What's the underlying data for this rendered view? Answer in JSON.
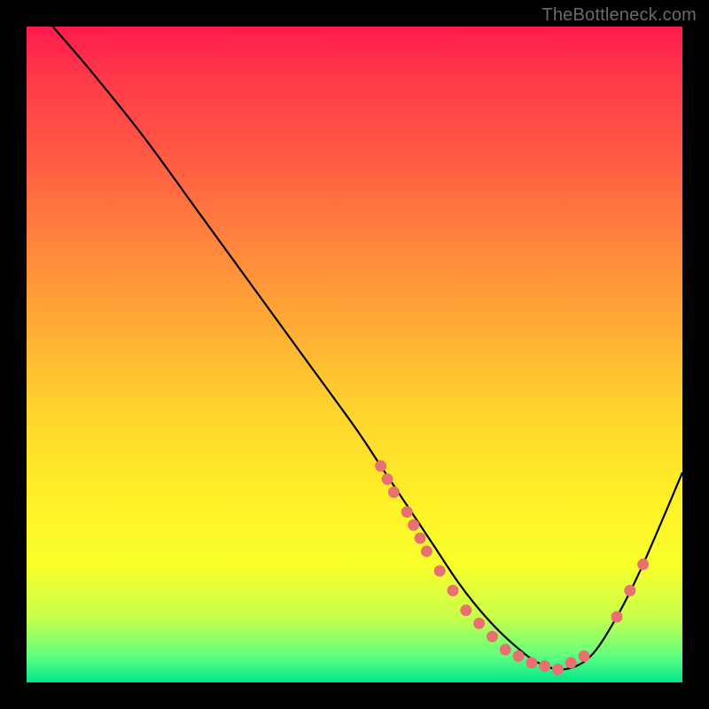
{
  "watermark": "TheBottleneck.com",
  "chart_data": {
    "type": "line",
    "title": "",
    "xlabel": "",
    "ylabel": "",
    "xlim": [
      0,
      100
    ],
    "ylim": [
      0,
      100
    ],
    "series": [
      {
        "name": "curve",
        "x": [
          4,
          10,
          18,
          26,
          34,
          42,
          50,
          54,
          58,
          62,
          66,
          70,
          74,
          78,
          82,
          86,
          90,
          94,
          100
        ],
        "y": [
          100,
          93,
          83,
          72,
          61,
          50,
          39,
          33,
          27,
          21,
          15,
          10,
          6,
          3,
          2,
          4,
          10,
          18,
          32
        ]
      }
    ],
    "markers": [
      {
        "x": 54,
        "y": 33
      },
      {
        "x": 55,
        "y": 31
      },
      {
        "x": 56,
        "y": 29
      },
      {
        "x": 58,
        "y": 26
      },
      {
        "x": 59,
        "y": 24
      },
      {
        "x": 60,
        "y": 22
      },
      {
        "x": 61,
        "y": 20
      },
      {
        "x": 63,
        "y": 17
      },
      {
        "x": 65,
        "y": 14
      },
      {
        "x": 67,
        "y": 11
      },
      {
        "x": 69,
        "y": 9
      },
      {
        "x": 71,
        "y": 7
      },
      {
        "x": 73,
        "y": 5
      },
      {
        "x": 75,
        "y": 4
      },
      {
        "x": 77,
        "y": 3
      },
      {
        "x": 79,
        "y": 2.5
      },
      {
        "x": 81,
        "y": 2
      },
      {
        "x": 83,
        "y": 3
      },
      {
        "x": 85,
        "y": 4
      },
      {
        "x": 90,
        "y": 10
      },
      {
        "x": 92,
        "y": 14
      },
      {
        "x": 94,
        "y": 18
      }
    ],
    "marker_color": "#e87070",
    "curve_color": "#000000"
  }
}
